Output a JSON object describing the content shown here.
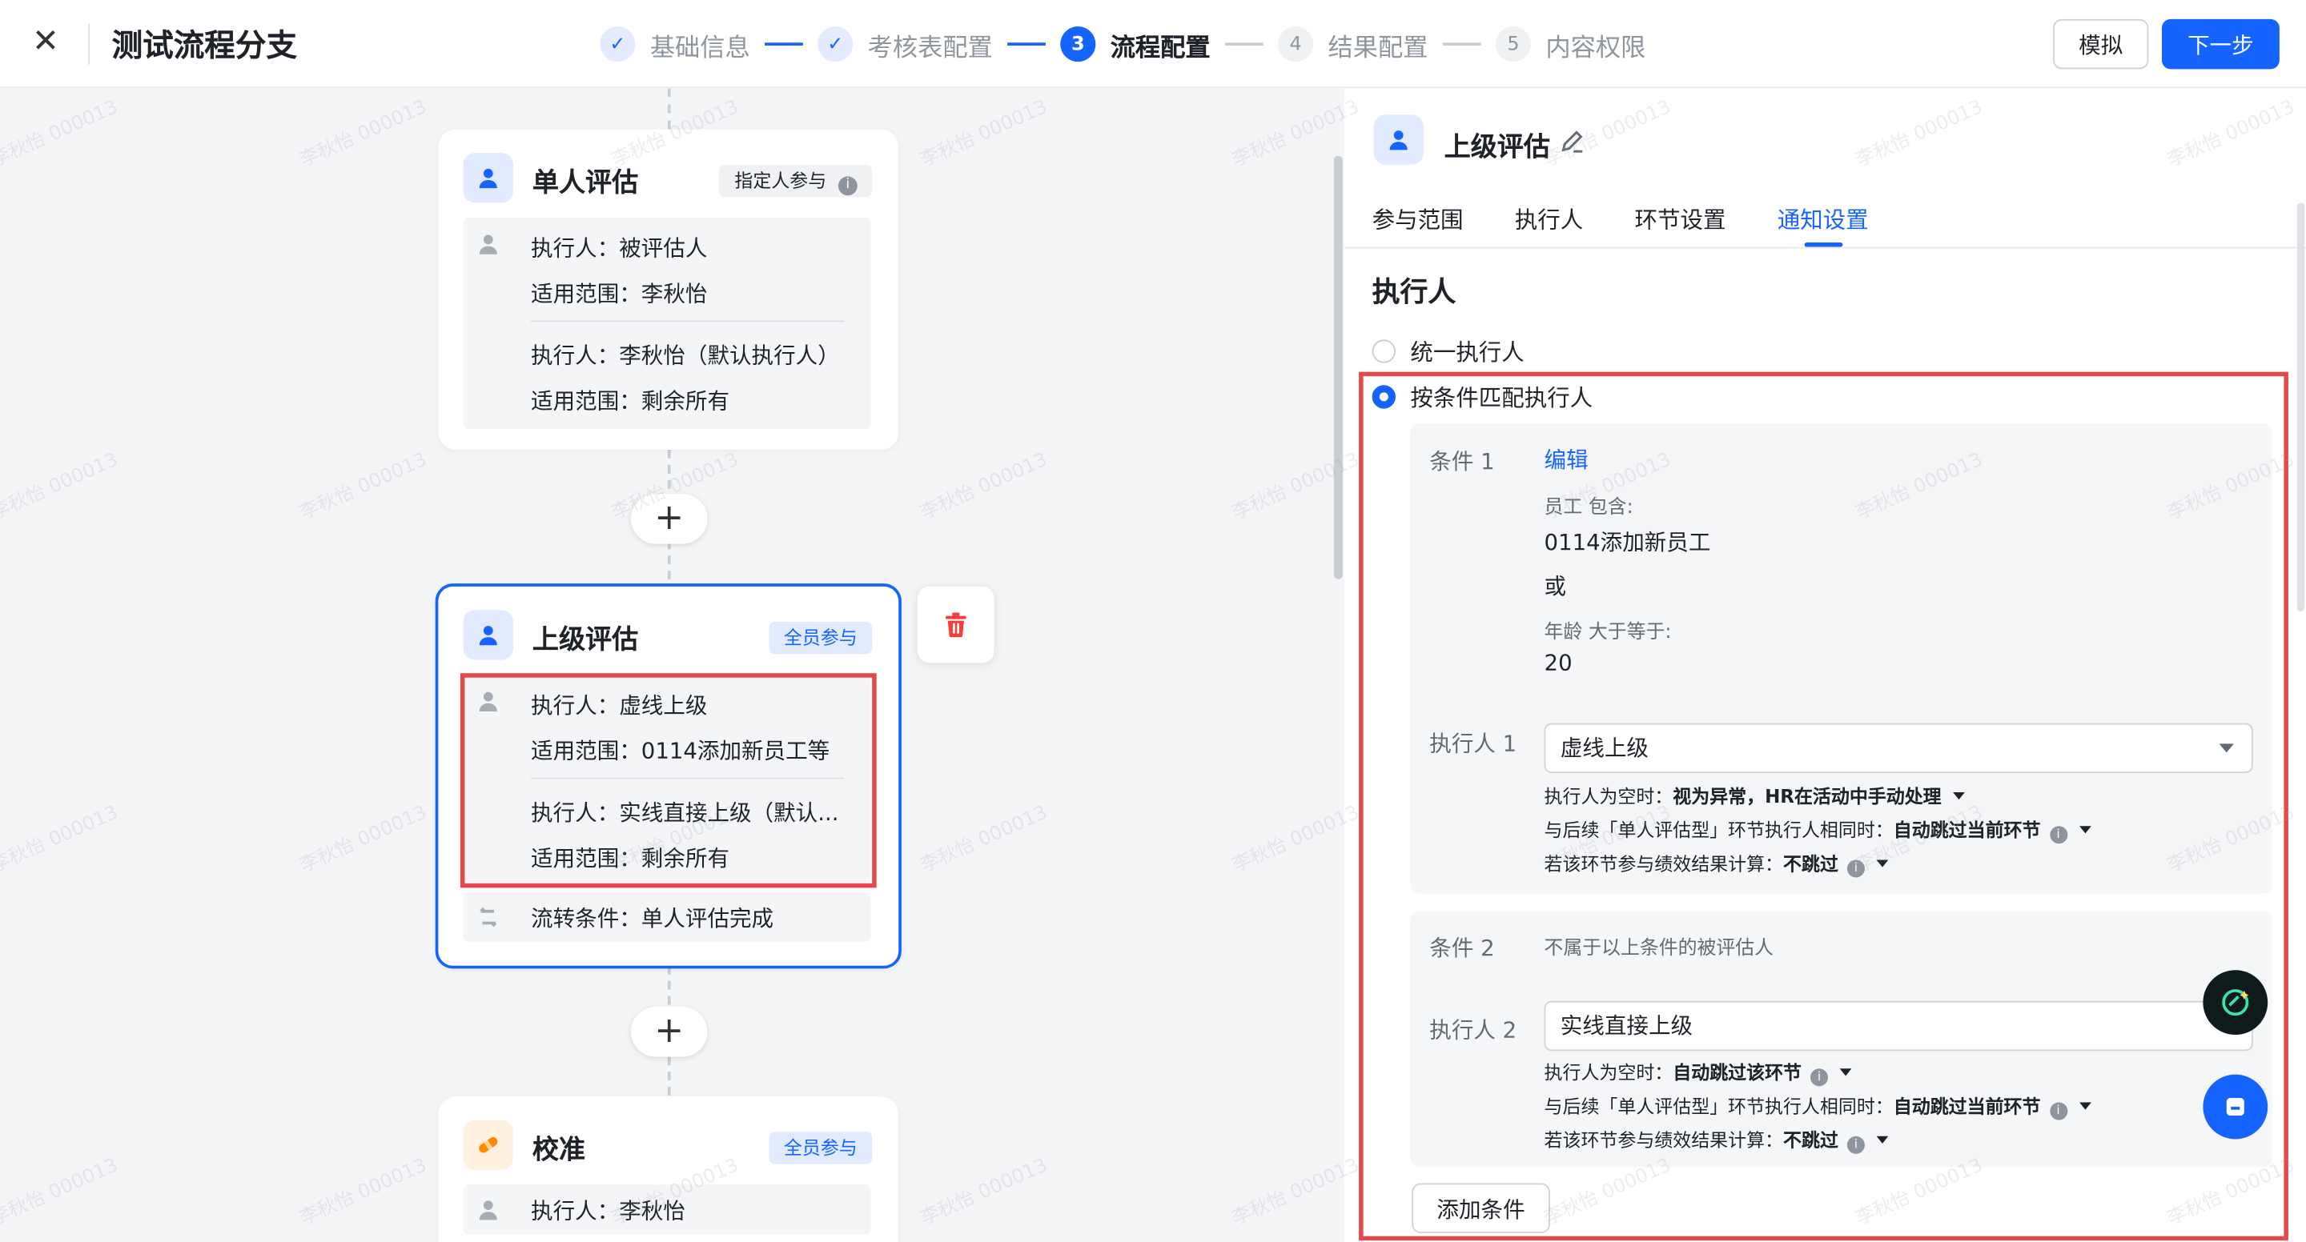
{
  "header": {
    "title": "测试流程分支",
    "steps": [
      {
        "num": "✓",
        "label": "基础信息",
        "state": "done"
      },
      {
        "num": "✓",
        "label": "考核表配置",
        "state": "done"
      },
      {
        "num": "3",
        "label": "流程配置",
        "state": "active"
      },
      {
        "num": "4",
        "label": "结果配置",
        "state": "todo"
      },
      {
        "num": "5",
        "label": "内容权限",
        "state": "todo"
      }
    ],
    "simulate_label": "模拟",
    "next_label": "下一步"
  },
  "canvas": {
    "cards": [
      {
        "title": "单人评估",
        "tag": "指定人参与",
        "rules": [
          {
            "executor": "执行人：被评估人",
            "scope": "适用范围：李秋怡"
          },
          {
            "executor": "执行人：李秋怡（默认执行人）",
            "scope": "适用范围：剩余所有"
          }
        ]
      },
      {
        "title": "上级评估",
        "tag": "全员参与",
        "rules": [
          {
            "executor": "执行人：虚线上级",
            "scope": "适用范围：0114添加新员工等"
          },
          {
            "executor": "执行人：实线直接上级（默认...",
            "scope": "适用范围：剩余所有"
          }
        ],
        "flow_condition": "流转条件：单人评估完成"
      },
      {
        "title": "校准",
        "tag": "全员参与",
        "rules": [
          {
            "executor": "执行人：李秋怡"
          }
        ]
      }
    ],
    "plus_label": "+"
  },
  "panel": {
    "title": "上级评估",
    "tabs": [
      "参与范围",
      "执行人",
      "环节设置",
      "通知设置"
    ],
    "active_tab": "通知设置",
    "section_title": "执行人",
    "radio_unified": "统一执行人",
    "radio_conditional": "按条件匹配执行人",
    "condition1": {
      "label": "条件 1",
      "edit_link": "编辑",
      "field1": "员工 包含:",
      "value1": "0114添加新员工",
      "or_text": "或",
      "field2": "年龄 大于等于:",
      "value2": "20",
      "executor_label": "执行人 1",
      "executor_value": "虚线上级",
      "opt_empty_prefix": "执行人为空时：",
      "opt_empty_value": "视为异常，HR在活动中手动处理",
      "opt_same_prefix": "与后续「单人评估型」环节执行人相同时：",
      "opt_same_value": "自动跳过当前环节",
      "opt_calc_prefix": "若该环节参与绩效结果计算：",
      "opt_calc_value": "不跳过"
    },
    "condition2": {
      "label": "条件 2",
      "desc": "不属于以上条件的被评估人",
      "executor_label": "执行人 2",
      "executor_value": "实线直接上级",
      "opt_empty_prefix": "执行人为空时：",
      "opt_empty_value": "自动跳过该环节",
      "opt_same_prefix": "与后续「单人评估型」环节执行人相同时：",
      "opt_same_value": "自动跳过当前环节",
      "opt_calc_prefix": "若该环节参与绩效结果计算：",
      "opt_calc_value": "不跳过"
    },
    "add_condition_label": "添加条件"
  },
  "watermark_text": "李秋怡 000013",
  "colors": {
    "accent": "#1664ff",
    "highlight": "#e5484d",
    "delete": "#f53f3f"
  }
}
